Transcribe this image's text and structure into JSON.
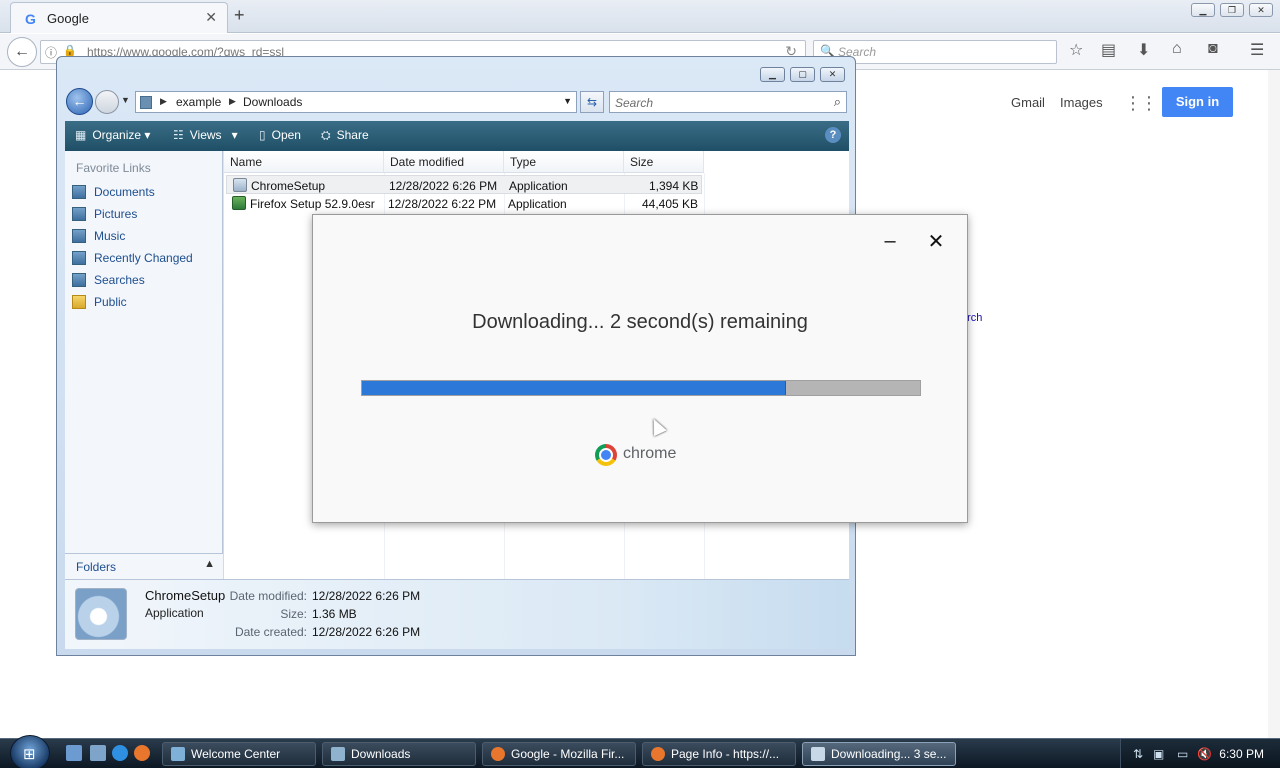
{
  "firefox": {
    "tab_title": "Google",
    "url": "https://www.google.com/?gws_rd=ssl",
    "search_placeholder": "Search"
  },
  "google_page": {
    "gmail": "Gmail",
    "images": "Images",
    "sign_in": "Sign in",
    "search_fragment": "arch"
  },
  "explorer": {
    "breadcrumb": [
      "example",
      "Downloads"
    ],
    "search_placeholder": "Search",
    "commands": {
      "organize": "Organize",
      "views": "Views",
      "open": "Open",
      "share": "Share"
    },
    "nav_header": "Favorite Links",
    "nav_items": [
      {
        "label": "Documents",
        "icon": "documents-icon"
      },
      {
        "label": "Pictures",
        "icon": "pictures-icon"
      },
      {
        "label": "Music",
        "icon": "music-icon"
      },
      {
        "label": "Recently Changed",
        "icon": "recent-icon"
      },
      {
        "label": "Searches",
        "icon": "searches-icon"
      },
      {
        "label": "Public",
        "icon": "folder-icon"
      }
    ],
    "folders_label": "Folders",
    "columns": [
      "Name",
      "Date modified",
      "Type",
      "Size"
    ],
    "files": [
      {
        "name": "ChromeSetup",
        "modified": "12/28/2022 6:26 PM",
        "type": "Application",
        "size": "1,394 KB"
      },
      {
        "name": "Firefox Setup 52.9.0esr",
        "modified": "12/28/2022 6:22 PM",
        "type": "Application",
        "size": "44,405 KB"
      }
    ],
    "details": {
      "name": "ChromeSetup",
      "type": "Application",
      "date_modified_label": "Date modified:",
      "date_modified": "12/28/2022 6:26 PM",
      "size_label": "Size:",
      "size": "1.36 MB",
      "date_created_label": "Date created:",
      "date_created": "12/28/2022 6:26 PM"
    }
  },
  "installer": {
    "message": "Downloading... 2 second(s) remaining",
    "progress_percent": 76,
    "brand": "chrome",
    "colors": {
      "progress": "#2b78d8",
      "track": "#b5b5b5"
    }
  },
  "taskbar": {
    "buttons": [
      {
        "label": "Welcome Center",
        "icon": "welcome-center-icon"
      },
      {
        "label": "Downloads",
        "icon": "folder-icon"
      },
      {
        "label": "Google - Mozilla Fir...",
        "icon": "firefox-icon"
      },
      {
        "label": "Page Info - https://...",
        "icon": "firefox-icon"
      },
      {
        "label": "Downloading... 3 se...",
        "icon": "installer-icon"
      }
    ],
    "clock": "6:30 PM"
  }
}
